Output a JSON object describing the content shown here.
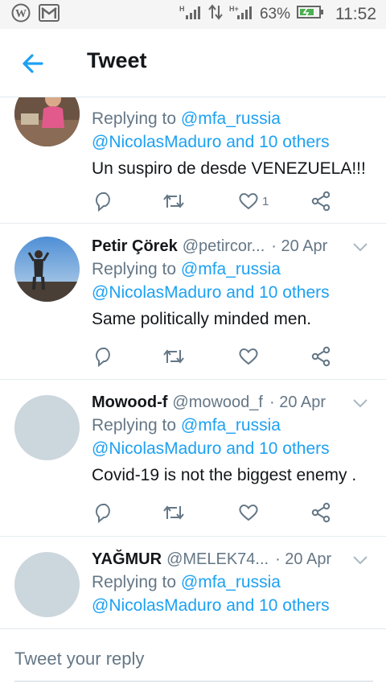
{
  "status_bar": {
    "battery": "63%",
    "time": "11:52",
    "left_icons": [
      "wordpress-icon",
      "gmail-icon"
    ],
    "right_icons": [
      "signal-h-icon",
      "data-arrows-icon",
      "signal-h-plus-icon",
      "battery-icon"
    ]
  },
  "header": {
    "title": "Tweet"
  },
  "replies": [
    {
      "name": "",
      "handle": "",
      "date": "",
      "replying_label": "Replying to",
      "reply_to": "@mfa_russia",
      "reply_to_more": "@NicolasMaduro and 10 others",
      "text": "Un suspiro de desde VENEZUELA!!!",
      "like_count": "1"
    },
    {
      "name": "Petir Çörek",
      "handle": "@petircor...",
      "date": "· 20 Apr",
      "replying_label": "Replying to",
      "reply_to": "@mfa_russia",
      "reply_to_more": "@NicolasMaduro and 10 others",
      "text": "Same politically minded men.",
      "like_count": ""
    },
    {
      "name": "Mowood-f",
      "handle": "@mowood_f",
      "date": "· 20 Apr",
      "replying_label": "Replying to",
      "reply_to": "@mfa_russia",
      "reply_to_more": "@NicolasMaduro and 10 others",
      "text": "Covid-19  is not the biggest enemy .",
      "like_count": ""
    },
    {
      "name": "YAĞMUR",
      "handle": "@MELEK74...",
      "date": "· 20 Apr",
      "replying_label": "Replying to",
      "reply_to": "@mfa_russia",
      "reply_to_more": "@NicolasMaduro and 10 others",
      "text": "",
      "like_count": ""
    }
  ],
  "composer": {
    "placeholder": "Tweet your reply"
  },
  "colors": {
    "accent": "#1da1f2",
    "secondary_text": "#657786",
    "primary_text": "#14171a"
  }
}
